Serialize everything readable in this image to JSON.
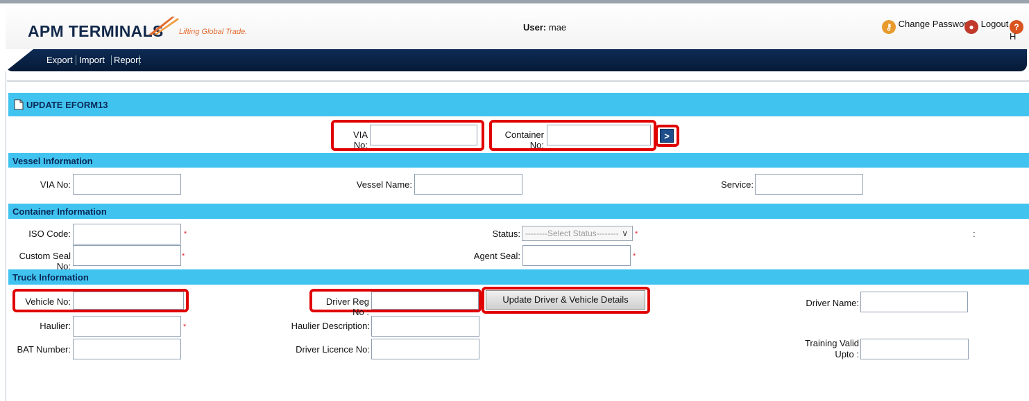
{
  "header": {
    "logo_text": "APM TERMINALS",
    "tagline": "Lifting Global Trade.",
    "user_label": "User:",
    "user_name": "mae",
    "change_password": "Change Password",
    "logout": "Logout",
    "help_partial": "H"
  },
  "nav": {
    "items": [
      "Export",
      "Import",
      "Report"
    ]
  },
  "page_title": "UPDATE EFORM13",
  "search": {
    "via_label": "VIA No:",
    "via_value": "",
    "container_label": "Container No:",
    "container_value": "",
    "go_glyph": ">"
  },
  "vessel": {
    "section_title": "Vessel Information",
    "via_label": "VIA No:",
    "vessel_name_label": "Vessel Name:",
    "service_label": "Service:"
  },
  "container": {
    "section_title": "Container Information",
    "iso_label": "ISO Code:",
    "status_label": "Status:",
    "status_selected": "--------Select Status--------",
    "custom_seal_label": "Custom Seal No:",
    "agent_seal_label": "Agent Seal:",
    "colon": ":",
    "required_mark": "*"
  },
  "truck": {
    "section_title": "Truck Information",
    "vehicle_label": "Vehicle No:",
    "driver_reg_label": "Driver Reg No :",
    "update_button": "Update Driver & Vehicle Details",
    "driver_name_label": "Driver Name:",
    "haulier_label": "Haulier:",
    "haulier_desc_label": "Haulier Description:",
    "bat_label": "BAT Number:",
    "driver_licence_label": "Driver Licence No:",
    "training_label_1": "Training Valid",
    "training_label_2": "Upto :"
  },
  "colors": {
    "section_bar": "#41c3f0",
    "navbar": "#0d2b55",
    "highlight": "#e00000"
  }
}
